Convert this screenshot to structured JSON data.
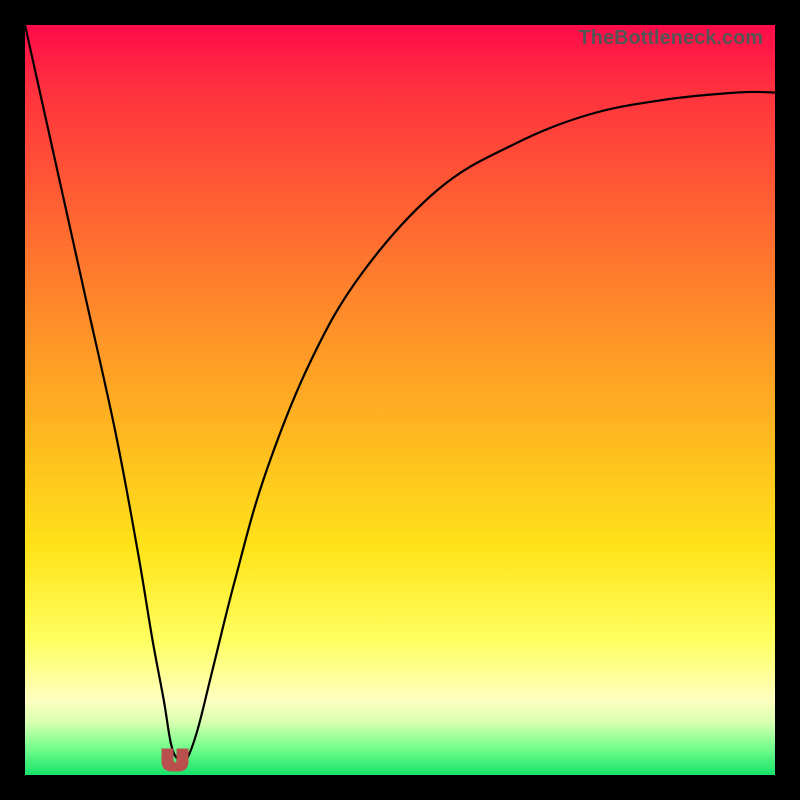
{
  "watermark": "TheBottleneck.com",
  "chart_data": {
    "type": "line",
    "title": "",
    "xlabel": "",
    "ylabel": "",
    "xlim": [
      0,
      100
    ],
    "ylim": [
      0,
      100
    ],
    "grid": false,
    "series": [
      {
        "name": "bottleneck-curve",
        "x": [
          0,
          4,
          8,
          12,
          15,
          17,
          18.5,
          19.5,
          20.5,
          21.5,
          23,
          25,
          28,
          32,
          38,
          45,
          55,
          65,
          75,
          85,
          95,
          100
        ],
        "y": [
          100,
          82,
          64,
          46,
          30,
          18,
          10,
          4,
          2,
          2,
          6,
          14,
          26,
          40,
          55,
          67,
          78,
          84,
          88,
          90,
          91,
          91
        ]
      }
    ],
    "annotations": [
      {
        "name": "curve-minimum",
        "x": 20,
        "y": 2,
        "shape": "u-marker",
        "color": "#b9504e"
      }
    ],
    "background_gradient": {
      "direction": "vertical",
      "stops": [
        {
          "pos": 0.0,
          "color": "#ff0a4a"
        },
        {
          "pos": 0.22,
          "color": "#ff5a34"
        },
        {
          "pos": 0.55,
          "color": "#ffb91f"
        },
        {
          "pos": 0.82,
          "color": "#ffff60"
        },
        {
          "pos": 0.93,
          "color": "#d8ffb0"
        },
        {
          "pos": 1.0,
          "color": "#17e36a"
        }
      ]
    }
  }
}
